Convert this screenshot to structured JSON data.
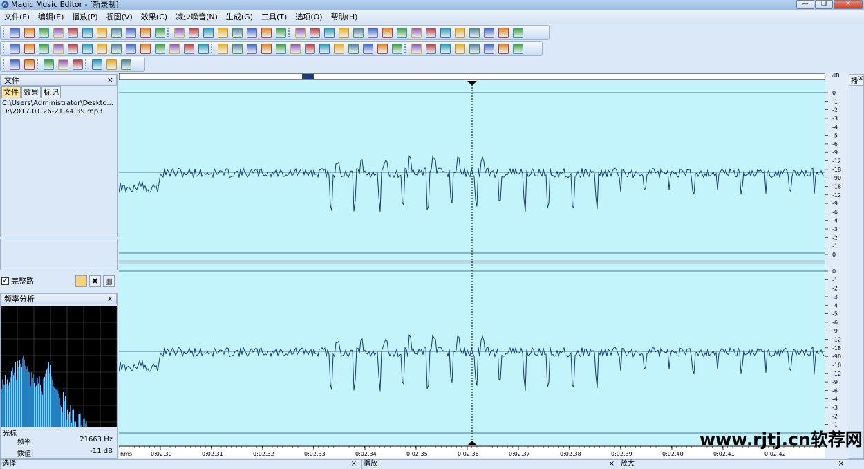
{
  "app": {
    "title": "Magic Music Editor - [新录制]"
  },
  "menu": [
    "文件(F)",
    "编辑(E)",
    "播放(P)",
    "视图(V)",
    "效果(C)",
    "减少噪音(N)",
    "生成(G)",
    "工具(T)",
    "选项(O)",
    "帮助(H)"
  ],
  "file_panel": {
    "title": "文件",
    "tabs": [
      "文件",
      "效果",
      "标记"
    ],
    "active_tab": "文件",
    "files": [
      "C:\\Users\\Administrator\\Deskto...",
      "D:\\2017.01.26-21.44.39.mp3"
    ]
  },
  "full_path": {
    "checked": true,
    "label": "完整路"
  },
  "freq_panel": {
    "title": "频率分析",
    "cursor_label": "光标",
    "freq_label": "频率:",
    "freq_value": "21663 Hz",
    "value_label": "数值:",
    "value_value": "-11 dB"
  },
  "bottom_panels": [
    "选择",
    "播放",
    "放大"
  ],
  "right_panel": {
    "label": "播"
  },
  "wave": {
    "db_header": "dB",
    "db_labels": [
      "0",
      "-1",
      "-2",
      "-3",
      "-4",
      "-5",
      "-6",
      "-9",
      "-12",
      "-18",
      "-90",
      "-18",
      "-12",
      "-9",
      "-6",
      "-4",
      "-3",
      "-2",
      "-1",
      "0"
    ],
    "time_unit": "hms",
    "time_labels": [
      "0:02.30",
      "0:02.31",
      "0:02.32",
      "0:02.33",
      "0:02.34",
      "0:02.35",
      "0:02.36",
      "0:02.37",
      "0:02.38",
      "0:02.39",
      "0:02.40",
      "0:02.41",
      "0:02.42"
    ],
    "cursor_time": "0:02.36",
    "bg_color": "#c4f4fb",
    "wave_color": "#1b3a6e"
  },
  "watermark": "www.rjtj.cn软荐网"
}
